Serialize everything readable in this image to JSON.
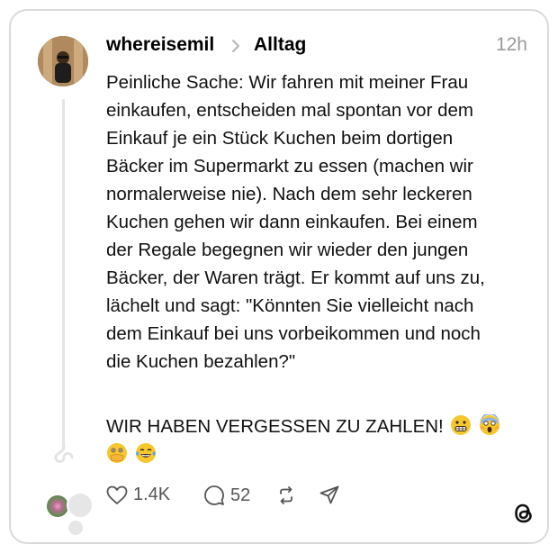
{
  "post": {
    "username": "whereisemil",
    "topic": "Alltag",
    "timestamp": "12h",
    "body": "Peinliche Sache: Wir fahren mit meiner Frau\neinkaufen, entscheiden mal spontan vor dem\nEinkauf je ein Stück Kuchen beim dortigen\nBäcker im Supermarkt zu essen (machen wir\nnormalerweise nie). Nach dem sehr leckeren\nKuchen gehen wir dann einkaufen. Bei einem\nder Regale begegnen wir wieder den jungen\nBäcker, der Waren trägt. Er kommt auf uns zu,\nlächelt und sagt: \"Könnten Sie vielleicht nach\ndem Einkauf bei uns vorbeikommen und noch\ndie Kuchen bezahlen?\"",
    "emphasis": "WIR HABEN VERGESSEN ZU ZAHLEN!",
    "emojis": [
      "grimacing-face",
      "face-screaming-in-fear",
      "face-with-open-eyes-and-hand-over-mouth",
      "face-with-tears-of-joy"
    ]
  },
  "actions": {
    "likes": "1.4K",
    "replies": "52",
    "repost_icon": "repost-icon",
    "share_icon": "share-icon"
  },
  "brand": {
    "logo": "threads-logo-icon"
  }
}
